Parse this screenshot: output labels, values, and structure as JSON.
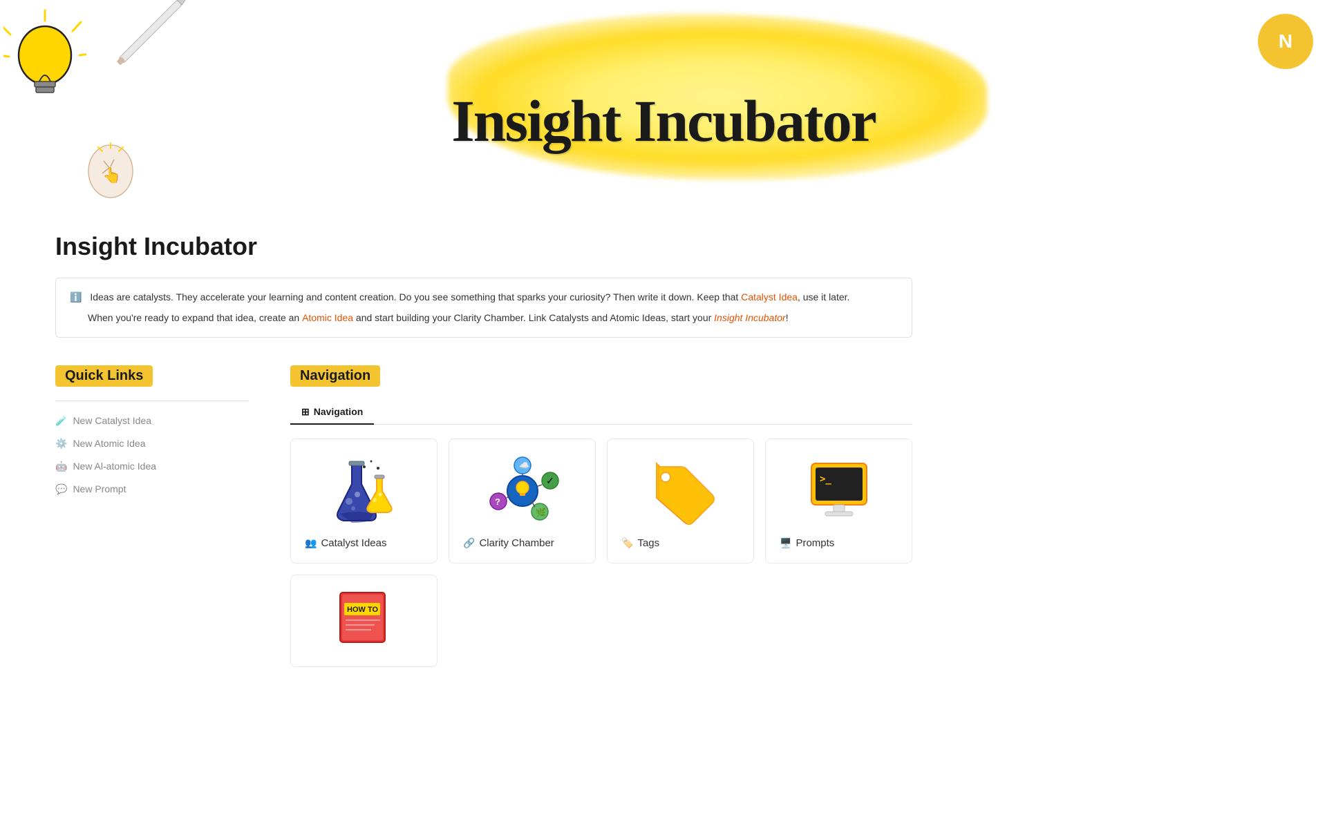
{
  "hero": {
    "title": "Insight Incubator",
    "notion_label": "N"
  },
  "page": {
    "title": "Insight Incubator"
  },
  "info": {
    "text1": "Ideas are catalysts. They accelerate your learning and content creation. Do you see something that sparks your curiosity? Then write it down. Keep that ",
    "link1": "Catalyst Idea",
    "text2": ", use it later.",
    "text3": "When you're ready to expand that idea, create an ",
    "link2": "Atomic Idea",
    "text4": " and start building your Clarity Chamber. Link Catalysts and Atomic Ideas, start your ",
    "link3": "Insight Incubator",
    "text5": "!"
  },
  "quick_links": {
    "header": "Quick Links",
    "items": [
      {
        "icon": "🧪",
        "label": "New Catalyst Idea"
      },
      {
        "icon": "⚙️",
        "label": "New Atomic Idea"
      },
      {
        "icon": "🤖",
        "label": "New Al-atomic Idea"
      },
      {
        "icon": "💬",
        "label": "New Prompt"
      }
    ]
  },
  "navigation": {
    "header": "Navigation",
    "tab_label": "Navigation",
    "tab_icon": "🔲",
    "cards": [
      {
        "id": "catalyst-ideas",
        "icon_type": "flask",
        "label": "Catalyst Ideas",
        "label_icon": "👥"
      },
      {
        "id": "clarity-chamber",
        "icon_type": "network",
        "label": "Clarity Chamber",
        "label_icon": "🔗"
      },
      {
        "id": "tags",
        "icon_type": "tag",
        "label": "Tags",
        "label_icon": "🏷️"
      },
      {
        "id": "prompts",
        "icon_type": "terminal",
        "label": "Prompts",
        "label_icon": "🖥️"
      }
    ],
    "bottom_cards": [
      {
        "id": "howto",
        "icon_type": "book"
      }
    ]
  }
}
